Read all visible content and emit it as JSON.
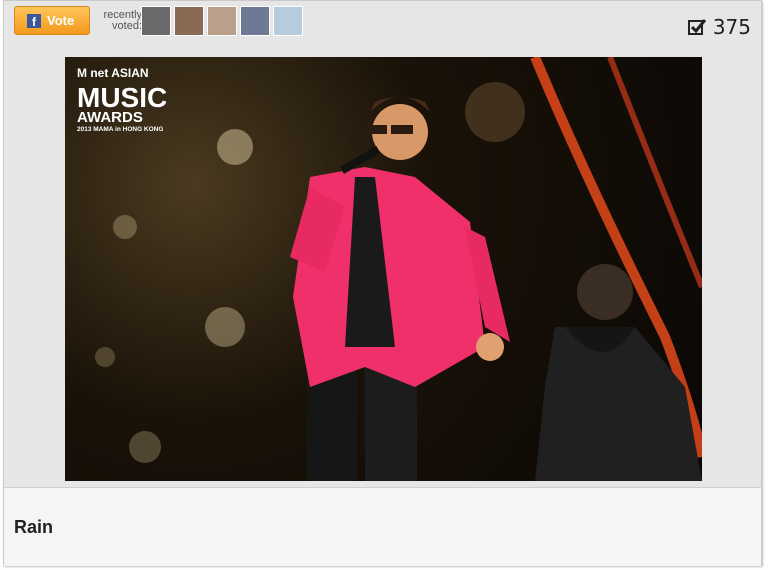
{
  "vote": {
    "label": "Vote",
    "fb_glyph": "f"
  },
  "recent": {
    "line1": "recently",
    "line2": "voted:",
    "avatars": [
      {
        "color": "#6a6a6a"
      },
      {
        "color": "#8a6a55"
      },
      {
        "color": "#b8a08a"
      },
      {
        "color": "#6e7a95"
      },
      {
        "color": "#b8cce0"
      }
    ]
  },
  "count": {
    "value": "375"
  },
  "photo": {
    "logo_line1": "M net ASIAN",
    "logo_line2": "MUSIC",
    "logo_line3": "AWARDS",
    "logo_line4": "2013 MAMA in HONG KONG"
  },
  "caption": {
    "name": "Rain"
  }
}
